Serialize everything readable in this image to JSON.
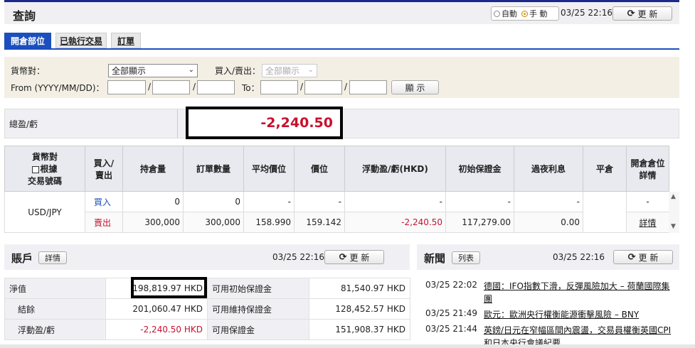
{
  "header": {
    "title": "查詢",
    "mode_auto": "自動",
    "mode_manual": "手 動",
    "timestamp": "03/25 22:16",
    "refresh_label": "更 新"
  },
  "tabs": [
    {
      "label": "開倉部位",
      "active": true
    },
    {
      "label": "已執行交易",
      "active": false
    },
    {
      "label": "訂單",
      "active": false
    }
  ],
  "filter": {
    "currency_pair_label": "貨幣對：",
    "currency_pair_value": "全部顯示",
    "buy_sell_label": "買入/賣出：",
    "buy_sell_value": "全部顯示",
    "from_label": "From (YYYY/MM/DD)：",
    "to_label": "To：",
    "date_sep": "/",
    "show_button": "顯 示"
  },
  "summary": {
    "label": "總盈/虧",
    "value": "-2,240.50"
  },
  "positions": {
    "headers": [
      "貨幣對",
      "根據",
      "交易號碼",
      "買入/",
      "賣出",
      "持倉量",
      "訂單數量",
      "平均價位",
      "價位",
      "浮動盈/虧(HKD)",
      "初始保證金",
      "過夜利息",
      "平倉",
      "開倉倉位",
      "詳情"
    ],
    "pair": "USD/JPY",
    "rows": [
      {
        "side": "買入",
        "qty": "0",
        "order_qty": "0",
        "avg": "-",
        "price": "-",
        "pl": "-",
        "margin": "-",
        "overnight": "-",
        "close": "",
        "detail": "-"
      },
      {
        "side": "賣出",
        "qty": "300,000",
        "order_qty": "300,000",
        "avg": "158.990",
        "price": "159.142",
        "pl": "-2,240.50",
        "margin": "117,279.00",
        "overnight": "0.00",
        "close": "",
        "detail": "詳情"
      }
    ]
  },
  "account": {
    "title": "賬戶",
    "detail_button": "詳情",
    "timestamp": "03/25 22:16",
    "refresh_label": "更 新",
    "rows": [
      {
        "label": "淨值",
        "value": "198,819.97 HKD",
        "label2": "可用初始保證金",
        "value2": "81,540.97 HKD"
      },
      {
        "label": "結餘",
        "value": "201,060.47 HKD",
        "label2": "可用維持保證金",
        "value2": "128,452.57 HKD"
      },
      {
        "label": "浮動盈/虧",
        "value": "-2,240.50 HKD",
        "label2": "可用保證金",
        "value2": "151,908.37 HKD"
      }
    ]
  },
  "news": {
    "title": "新聞",
    "list_button": "列表",
    "timestamp": "03/25 22:16",
    "refresh_label": "更 新",
    "items": [
      {
        "time": "03/25 22:02",
        "headline": "德國：IFO指數下滑，反彈風險加大 – 荷蘭國際集團"
      },
      {
        "time": "03/25 21:49",
        "headline": "歐元：歐洲央行權衡能源衝擊風險 – BNY"
      },
      {
        "time": "03/25 21:44",
        "headline": "英鎊/日元在窄幅區間內震盪，交易員權衡英國CPI和日本央行會議紀要"
      }
    ]
  },
  "colors": {
    "accent": "#1b4fbd",
    "negative": "#c8102e",
    "filter_bg": "#f3efe4"
  }
}
